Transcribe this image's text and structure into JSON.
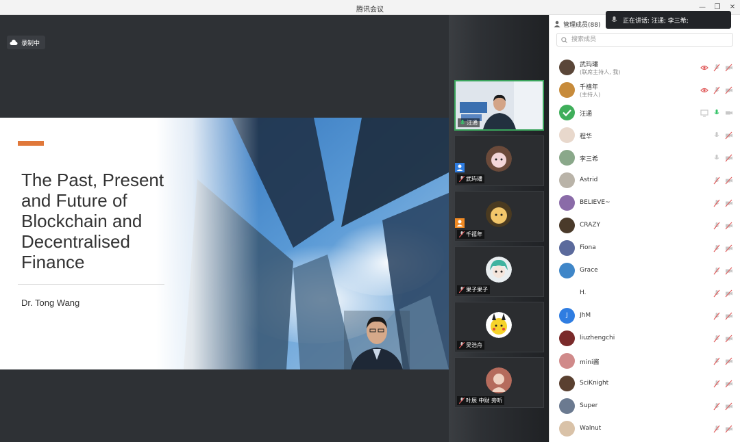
{
  "window": {
    "title": "腾讯会议"
  },
  "recording": {
    "label": "录制中"
  },
  "slide": {
    "title": "The Past, Present and Future of Blockchain and Decentralised Finance",
    "author": "Dr. Tong Wang"
  },
  "thumbnails": [
    {
      "name": "汪通",
      "active": true,
      "mic": "on"
    },
    {
      "name": "武玙璠",
      "badge": "host-co",
      "mic": "muted"
    },
    {
      "name": "千禧年",
      "badge": "host",
      "mic": "muted"
    },
    {
      "name": "果子果子",
      "mic": "muted"
    },
    {
      "name": "吴浩舟",
      "mic": "muted"
    },
    {
      "name": "叶辰 中财 旁听",
      "mic": "muted"
    }
  ],
  "panel": {
    "title": "管理成员(88)",
    "search_placeholder": "搜索成员"
  },
  "speaking_toast": {
    "label": "正在讲话: 汪通; 李三希;"
  },
  "members": [
    {
      "name": "武玙璠",
      "sub": "(联席主持人, 我)",
      "icons": [
        "eye-icon",
        "mic-muted-icon",
        "camera-off-icon"
      ]
    },
    {
      "name": "千禧年",
      "sub": "(主持人)",
      "icons": [
        "eye-icon",
        "mic-muted-icon",
        "camera-off-icon"
      ]
    },
    {
      "name": "汪通",
      "sub": "",
      "icons": [
        "screen-share-icon",
        "mic-active-icon",
        "camera-icon"
      ]
    },
    {
      "name": "程华",
      "sub": "",
      "icons": [
        "mic-icon",
        "camera-off-icon"
      ]
    },
    {
      "name": "李三希",
      "sub": "",
      "icons": [
        "mic-icon",
        "camera-off-icon"
      ]
    },
    {
      "name": "Astrid",
      "sub": "",
      "icons": [
        "mic-muted-icon",
        "camera-off-icon"
      ]
    },
    {
      "name": "BELIEVE~",
      "sub": "",
      "icons": [
        "mic-muted-icon",
        "camera-off-icon"
      ]
    },
    {
      "name": "CRAZY",
      "sub": "",
      "icons": [
        "mic-muted-icon",
        "camera-off-icon"
      ]
    },
    {
      "name": "Fiona",
      "sub": "",
      "icons": [
        "mic-muted-icon",
        "camera-off-icon"
      ]
    },
    {
      "name": "Grace",
      "sub": "",
      "icons": [
        "mic-muted-icon",
        "camera-off-icon"
      ]
    },
    {
      "name": "H.",
      "sub": "",
      "icons": [
        "mic-muted-icon",
        "camera-off-icon"
      ]
    },
    {
      "name": "JhM",
      "sub": "",
      "icons": [
        "mic-muted-icon",
        "camera-off-icon"
      ]
    },
    {
      "name": "liuzhengchi",
      "sub": "",
      "icons": [
        "mic-muted-icon",
        "camera-off-icon"
      ]
    },
    {
      "name": "mini酱",
      "sub": "",
      "icons": [
        "mic-muted-icon",
        "camera-off-icon"
      ]
    },
    {
      "name": "SciKnight",
      "sub": "",
      "icons": [
        "mic-muted-icon",
        "camera-off-icon"
      ]
    },
    {
      "name": "Super",
      "sub": "",
      "icons": [
        "mic-muted-icon",
        "camera-off-icon"
      ]
    },
    {
      "name": "Walnut",
      "sub": "",
      "icons": [
        "mic-muted-icon",
        "camera-off-icon"
      ]
    }
  ],
  "colors": {
    "accent": "#e0783a",
    "active_border": "#3aa45c",
    "muted_red": "#e05a5a"
  }
}
